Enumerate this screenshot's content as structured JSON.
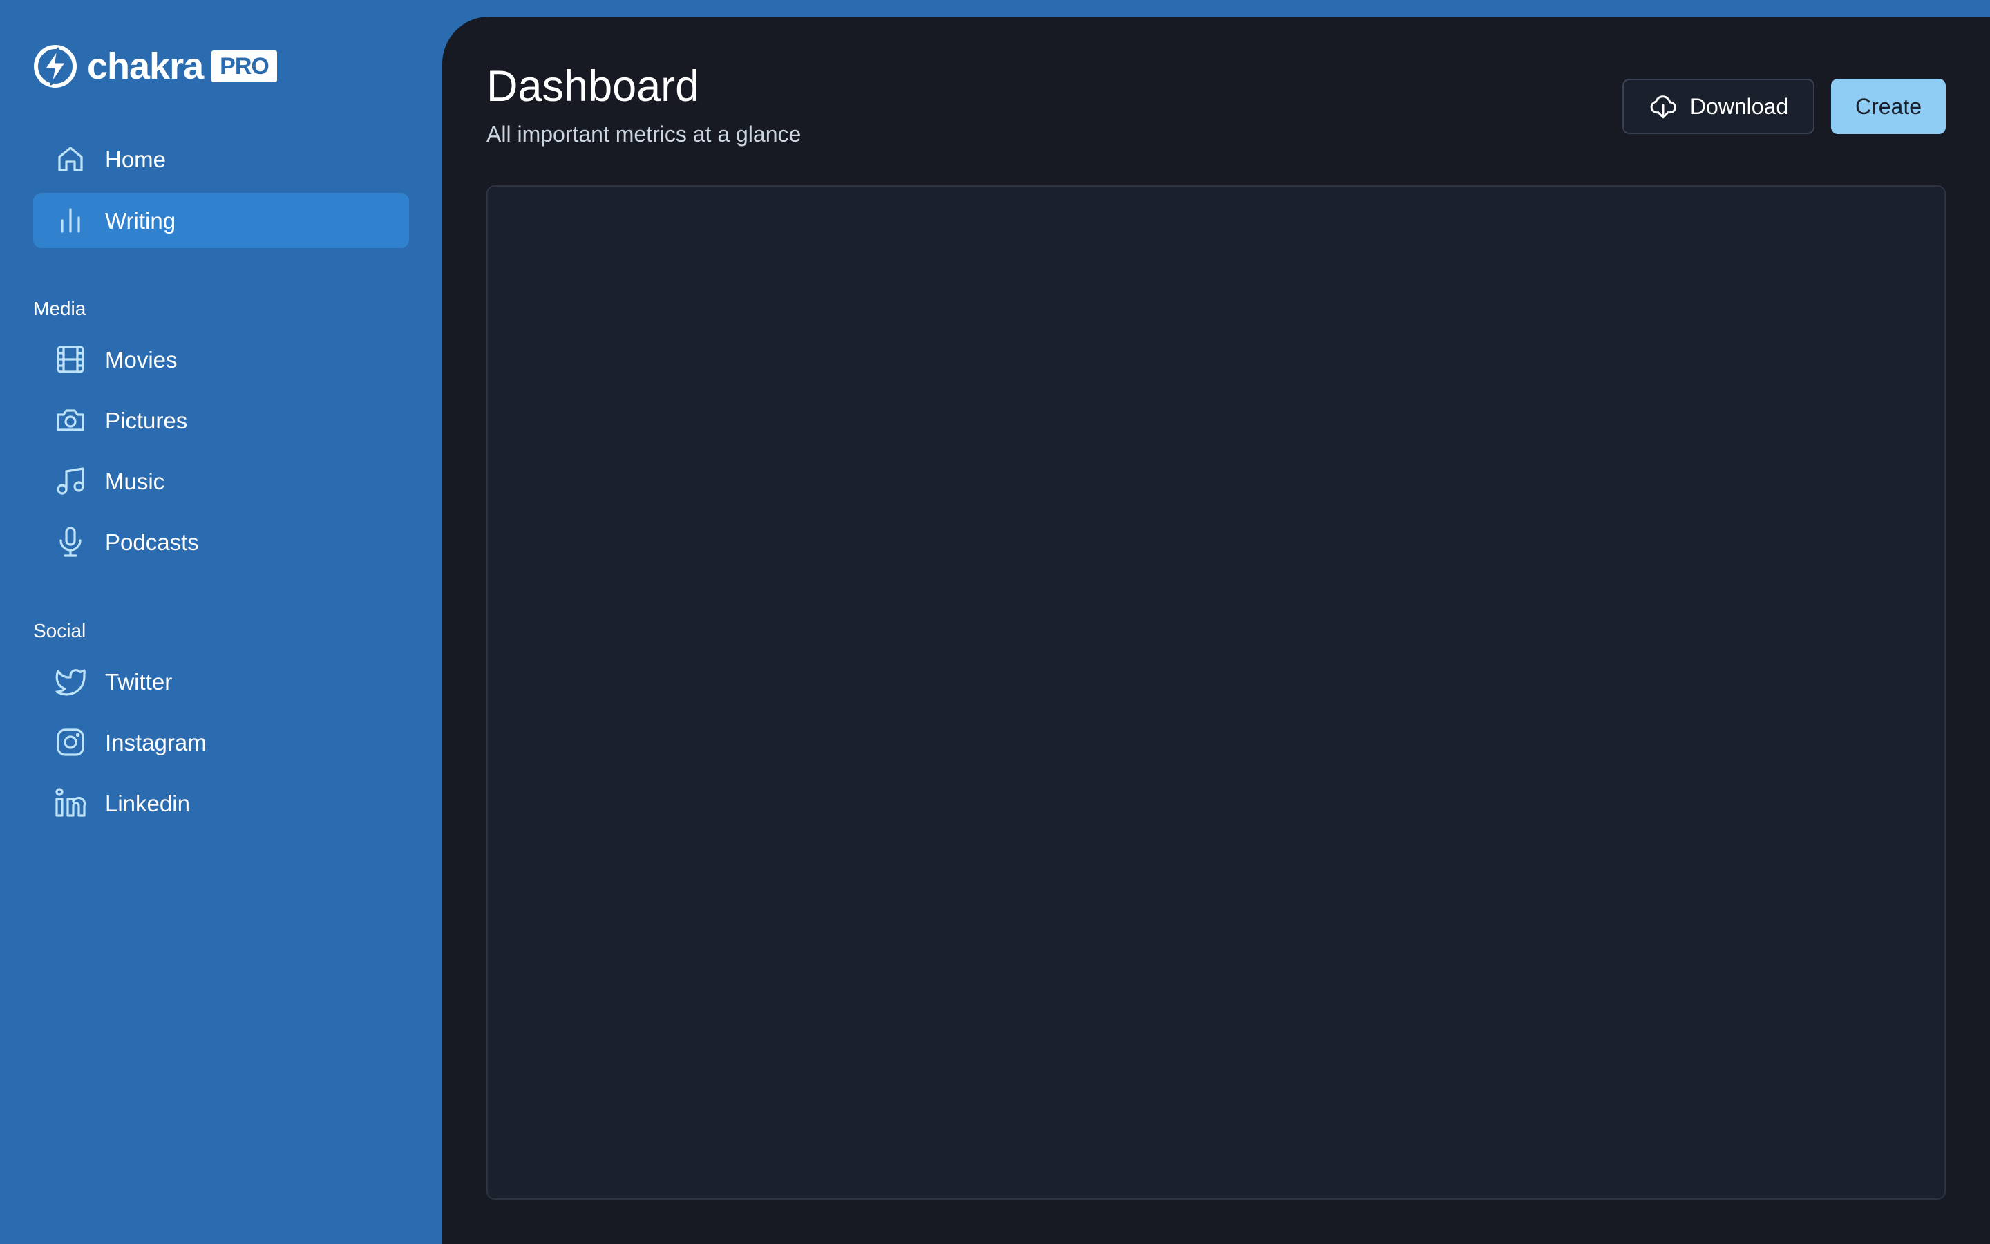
{
  "colors": {
    "sidebar_bg": "#2b6cb0",
    "active_item_bg": "#3182ce",
    "main_bg": "#171923",
    "card_bg": "#1a202c",
    "icon_color": "#bee3f8",
    "create_button_bg": "#90cdf4"
  },
  "brand": {
    "name": "chakra",
    "badge": "PRO",
    "icon": "lightning-bolt-icon"
  },
  "sidebar": {
    "primary_items": [
      {
        "label": "Home",
        "icon": "home-icon",
        "active": false
      },
      {
        "label": "Writing",
        "icon": "bar-chart-icon",
        "active": true
      }
    ],
    "sections": [
      {
        "title": "Media",
        "items": [
          {
            "label": "Movies",
            "icon": "film-icon"
          },
          {
            "label": "Pictures",
            "icon": "camera-icon"
          },
          {
            "label": "Music",
            "icon": "music-icon"
          },
          {
            "label": "Podcasts",
            "icon": "microphone-icon"
          }
        ]
      },
      {
        "title": "Social",
        "items": [
          {
            "label": "Twitter",
            "icon": "twitter-icon"
          },
          {
            "label": "Instagram",
            "icon": "instagram-icon"
          },
          {
            "label": "Linkedin",
            "icon": "linkedin-icon"
          }
        ]
      }
    ]
  },
  "header": {
    "title": "Dashboard",
    "subtitle": "All important metrics at a glance",
    "download_label": "Download",
    "download_icon": "cloud-download-icon",
    "create_label": "Create"
  }
}
